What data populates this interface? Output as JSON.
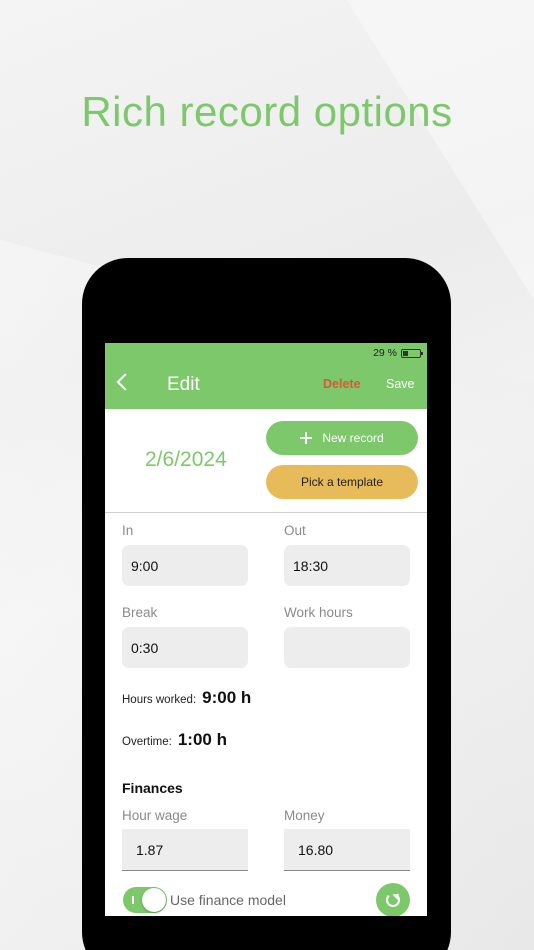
{
  "headline": "Rich record options",
  "status": {
    "battery": "29 %"
  },
  "appbar": {
    "title": "Edit",
    "delete_label": "Delete",
    "save_label": "Save"
  },
  "record": {
    "date": "2/6/2024",
    "new_record_label": "New record",
    "pick_template_label": "Pick a template"
  },
  "fields": {
    "in_label": "In",
    "in_value": "9:00",
    "out_label": "Out",
    "out_value": "18:30",
    "break_label": "Break",
    "break_value": "0:30",
    "work_hours_label": "Work hours",
    "work_hours_value": ""
  },
  "stats": {
    "hours_worked_label": "Hours worked:",
    "hours_worked_value": "9:00 h",
    "overtime_label": "Overtime:",
    "overtime_value": "1:00 h"
  },
  "finances": {
    "title": "Finances",
    "hour_wage_label": "Hour wage",
    "hour_wage_value": "1.87",
    "money_label": "Money",
    "money_value": "16.80",
    "use_finance_model_label": "Use finance model",
    "use_finance_model_on": true
  },
  "colors": {
    "accent": "#7cc86b",
    "template": "#e8bb5a",
    "danger": "#d65b35"
  },
  "icons": [
    "back-chevron-icon",
    "plus-icon",
    "battery-icon",
    "refresh-icon"
  ]
}
